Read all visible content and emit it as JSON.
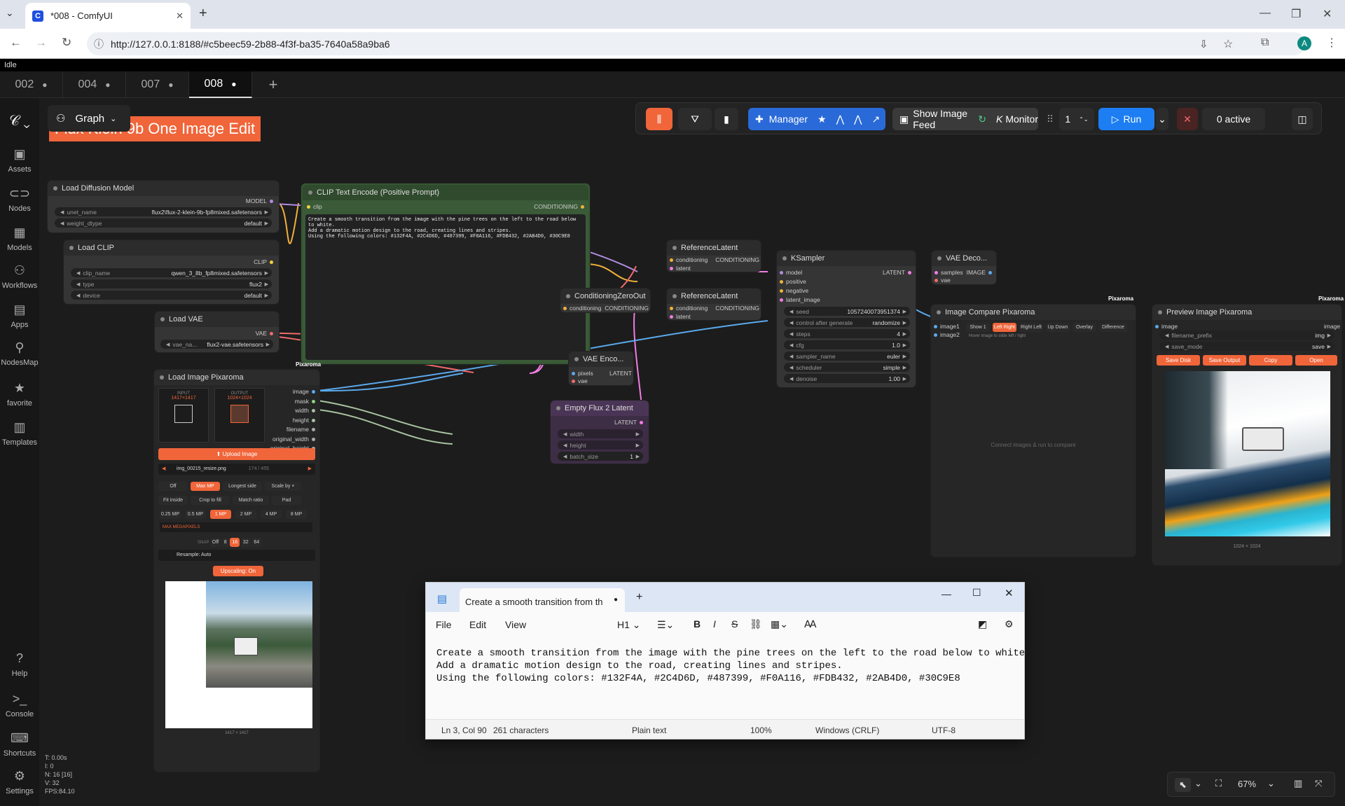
{
  "browser": {
    "tab_title": "*008 - ComfyUI",
    "url": "http://127.0.0.1:8188/#c5beec59-2b88-4f3f-ba35-7640a58a9ba6",
    "profile": "A"
  },
  "status": "Idle",
  "workflow_tabs": [
    {
      "label": "002"
    },
    {
      "label": "004"
    },
    {
      "label": "007"
    },
    {
      "label": "008"
    }
  ],
  "sidebar": {
    "items": [
      {
        "label": "Assets"
      },
      {
        "label": "Nodes"
      },
      {
        "label": "Models"
      },
      {
        "label": "Workflows"
      },
      {
        "label": "Apps"
      },
      {
        "label": "NodesMap"
      },
      {
        "label": "favorite"
      },
      {
        "label": "Templates"
      }
    ],
    "bottom": [
      {
        "label": "Help"
      },
      {
        "label": "Console"
      },
      {
        "label": "Shortcuts"
      },
      {
        "label": "Settings"
      }
    ]
  },
  "graph_label": "Graph",
  "toolbar": {
    "manager": "Manager",
    "image_feed": "Show Image Feed",
    "monitor": "Monitor",
    "queue_count": "1",
    "run": "Run",
    "active": "0 active"
  },
  "canvas": {
    "group_title": "Flux Klein 9b One Image Edit",
    "load_diffusion": {
      "title": "Load Diffusion Model",
      "out": "MODEL",
      "unet_label": "unet_name",
      "unet_value": "flux2\\flux-2-klein-9b-fp8mixed.safetensors",
      "dtype_label": "weight_dtype",
      "dtype_value": "default"
    },
    "load_clip": {
      "title": "Load CLIP",
      "out": "CLIP",
      "name_label": "clip_name",
      "name_value": "qwen_3_8b_fp8mixed.safetensors",
      "type_label": "type",
      "type_value": "flux2",
      "device_label": "device",
      "device_value": "default"
    },
    "load_vae": {
      "title": "Load VAE",
      "out": "VAE",
      "name_label": "vae_na...",
      "name_value": "flux2-vae.safetensors"
    },
    "clip_encode": {
      "title": "CLIP Text Encode (Positive Prompt)",
      "in": "clip",
      "out": "CONDITIONING",
      "text": "Create a smooth transition from the image with the pine trees on the left to the road below to white.\nAdd a dramatic motion design to the road, creating lines and stripes.\nUsing the following colors: #132F4A, #2C4D6D, #487399, #F0A116, #FDB432, #2AB4D0, #30C9E8"
    },
    "cond_zero": {
      "title": "ConditioningZeroOut",
      "in": "conditioning",
      "out": "CONDITIONING"
    },
    "ref1": {
      "title": "ReferenceLatent",
      "in1": "conditioning",
      "in2": "latent",
      "out": "CONDITIONING"
    },
    "ref2": {
      "title": "ReferenceLatent",
      "in1": "conditioning",
      "in2": "latent",
      "out": "CONDITIONING"
    },
    "vae_encode": {
      "title": "VAE Enco...",
      "in1": "pixels",
      "in2": "vae",
      "out": "LATENT"
    },
    "empty_latent": {
      "title": "Empty Flux 2 Latent",
      "out": "LATENT",
      "w": "width",
      "h": "height",
      "batch_label": "batch_size",
      "batch_value": "1"
    },
    "ksampler": {
      "title": "KSampler",
      "ins": [
        "model",
        "positive",
        "negative",
        "latent_image"
      ],
      "out": "LATENT",
      "widgets": [
        {
          "k": "seed",
          "v": "1057240073951374"
        },
        {
          "k": "control after generate",
          "v": "randomize"
        },
        {
          "k": "steps",
          "v": "4"
        },
        {
          "k": "cfg",
          "v": "1.0"
        },
        {
          "k": "sampler_name",
          "v": "euler"
        },
        {
          "k": "scheduler",
          "v": "simple"
        },
        {
          "k": "denoise",
          "v": "1.00"
        }
      ]
    },
    "vae_decode": {
      "title": "VAE Deco...",
      "in1": "samples",
      "in2": "vae",
      "out": "IMAGE"
    },
    "compare": {
      "title": "Image Compare Pixaroma",
      "badge": "Pixaroma",
      "in1": "image1",
      "in2": "image2",
      "modes": [
        "Show 1",
        "Left Right",
        "Right Left",
        "Up Down",
        "Overlay",
        "Difference"
      ],
      "hint": "Hover image to slide left / right",
      "empty": "Connect images & run to compare"
    },
    "preview": {
      "title": "Preview Image Pixaroma",
      "badge": "Pixaroma",
      "in": "image",
      "out": "image",
      "prefix_label": "filename_prefix",
      "prefix_value": "img",
      "mode_label": "save_mode",
      "mode_value": "save",
      "buttons": [
        "Save Disk",
        "Save Output",
        "Copy",
        "Open"
      ],
      "size": "1024 × 1024"
    },
    "load_image": {
      "title": "Load Image Pixaroma",
      "badge": "Pixaroma",
      "outs": [
        "image",
        "mask",
        "width",
        "height",
        "filename",
        "original_width",
        "original_height"
      ],
      "input_label": "INPUT",
      "input_size": "1417×1417",
      "output_label": "OUTPUT",
      "output_size": "1024×1024",
      "upload": "Upload Image",
      "file": "img_00215_resize.png",
      "file_idx": "174 / 455",
      "modes1": [
        "Off",
        "Max MP",
        "Longest side",
        "Scale by ×"
      ],
      "modes2": [
        "Fit inside",
        "Crop to fill",
        "Match ratio",
        "Pad"
      ],
      "mp": [
        "0.25 MP",
        "0.5 MP",
        "1 MP",
        "2 MP",
        "4 MP",
        "8 MP"
      ],
      "max_mp": "MAX MEGAPIXELS",
      "snap": [
        "SNAP",
        "Off",
        "8",
        "16",
        "32",
        "64"
      ],
      "resample": "Resample: Auto",
      "upscaling": "Upscaling: On",
      "size": "1417 × 1417"
    }
  },
  "stats": [
    "T: 0.00s",
    "I: 0",
    "N: 16 [16]",
    "V: 32",
    "FPS:84.10"
  ],
  "canvas_controls": {
    "zoom": "67%"
  },
  "notepad": {
    "tab": "Create a smooth transition from th",
    "menu": [
      "File",
      "Edit",
      "View"
    ],
    "heading": "H1",
    "lines": [
      "Create a smooth transition from the image with the pine trees on the left to the road below to white.",
      "Add a dramatic motion design to the road, creating lines and stripes.",
      "Using the following colors: #132F4A, #2C4D6D, #487399, #F0A116, #FDB432, #2AB4D0, #30C9E8"
    ],
    "status": {
      "pos": "Ln 3, Col 90",
      "chars": "261 characters",
      "format": "Plain text",
      "zoom": "100%",
      "eol": "Windows (CRLF)",
      "enc": "UTF-8"
    }
  },
  "colors": {
    "accent": "#f0653a",
    "run": "#1c7ef2",
    "manager": "#2a6ad8",
    "group": "#3d5a3a"
  }
}
